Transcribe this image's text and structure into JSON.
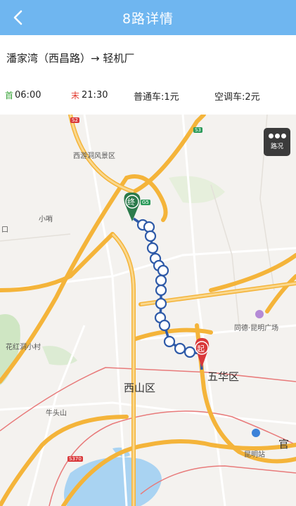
{
  "header": {
    "title": "8路详情",
    "back_icon": "chevron-left-icon"
  },
  "route": {
    "text": "潘家湾（西昌路）→ 轻机厂"
  },
  "info": {
    "first_tag": "首",
    "first_time": "06:00",
    "last_tag": "末",
    "last_time": "21:30",
    "normal_fare": "普通车:1元",
    "ac_fare": "空调车:2元"
  },
  "map": {
    "traffic_button_label": "路况",
    "end_marker": "终",
    "start_marker": "起",
    "labels": {
      "xishandong": "西游洞风景区",
      "xiaoshao": "小哨",
      "kou": "口",
      "huahongxiaocun": "花红洞小村",
      "niutoushan": "牛头山",
      "xishanqu": "西山区",
      "wuhuaqu": "五华区",
      "tongde": "同德·昆明广场",
      "kunmingzhan": "昆明站",
      "guan": "官",
      "road_s2": "S2",
      "road_g5": "G5",
      "road_s3": "S3",
      "road_s370": "S370"
    }
  },
  "colors": {
    "title_bar": "#6fb6f0",
    "route_line": "#2e5aa8",
    "stop_fill": "#ffffff",
    "end_marker": "#2b7a4b",
    "start_marker": "#d9383a",
    "expressway": "#f4b43a"
  }
}
